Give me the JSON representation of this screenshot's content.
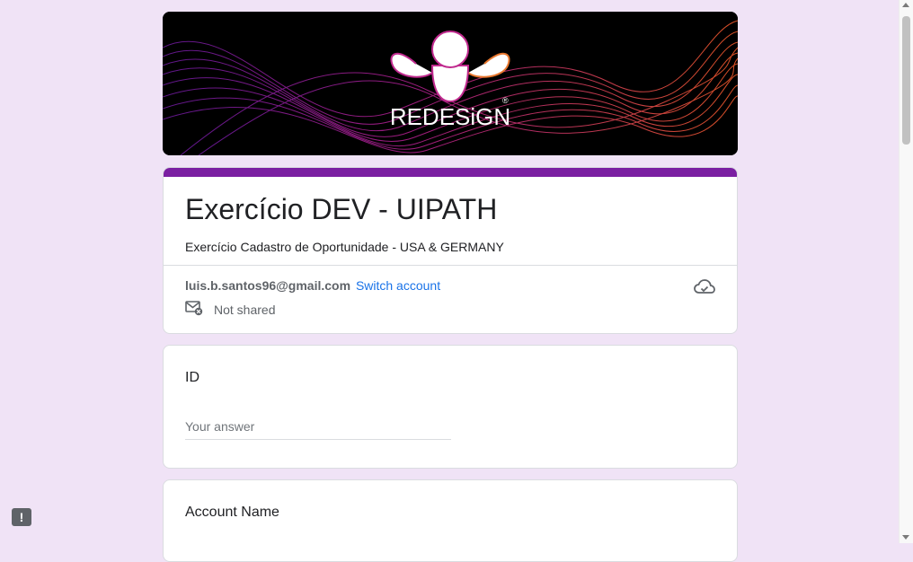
{
  "banner": {
    "brand_text": "REDESiGN",
    "registered_mark": "®"
  },
  "form": {
    "title": "Exercício DEV - UIPATH",
    "description": "Exercício Cadastro de Oportunidade - USA & GERMANY",
    "accent_color": "#7b1fa2"
  },
  "account": {
    "email": "luis.b.santos96@gmail.com",
    "switch_label": "Switch account",
    "shared_status": "Not shared"
  },
  "questions": [
    {
      "title": "ID",
      "placeholder": "Your answer"
    },
    {
      "title": "Account Name"
    }
  ],
  "feedback": {
    "label": "!"
  },
  "icons": {
    "shared": "mail-not-shared-icon",
    "cloud": "cloud-save-icon",
    "feedback": "report-issue-icon"
  },
  "colors": {
    "background": "#f0e3f6",
    "link": "#1a73e8",
    "banner_bg": "#000000"
  }
}
